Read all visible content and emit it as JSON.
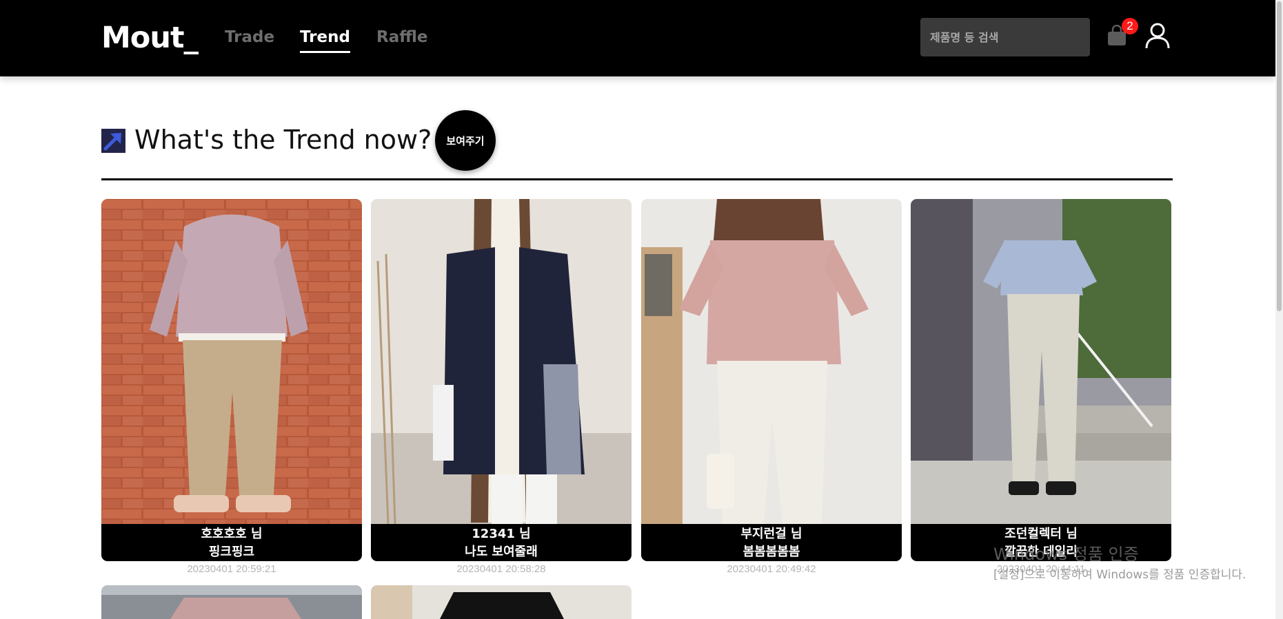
{
  "header": {
    "logo": "Mout_",
    "tabs": [
      {
        "label": "Trade",
        "active": false
      },
      {
        "label": "Trend",
        "active": true
      },
      {
        "label": "Raffle",
        "active": false
      }
    ],
    "search": {
      "placeholder": "제품명 등 검색",
      "value": ""
    },
    "cart": {
      "icon": "shopping-bag-icon",
      "badge_count": "2"
    },
    "user": {
      "icon": "user-icon"
    }
  },
  "section": {
    "title": "What's the Trend now?",
    "icon": "trend-arrow-icon",
    "show_button_label": "보여주기"
  },
  "cards": [
    {
      "author": "호호호호 님",
      "title": "핑크핑크",
      "date": "20230401 20:59:21"
    },
    {
      "author": "12341 님",
      "title": "나도 보여줄래",
      "date": "20230401 20:58:28"
    },
    {
      "author": "부지런걸 님",
      "title": "봄봄봄봄봄",
      "date": "20230401 20:49:42"
    },
    {
      "author": "조던컬렉터 님",
      "title": "깔끔한 데일리",
      "date": "20230401 20:44:11"
    }
  ],
  "watermark": {
    "title": "Windows 정품 인증",
    "subtitle": "[설정]으로 이동하여 Windows를 정품 인증합니다."
  },
  "colors": {
    "header_bg": "#000000",
    "accent_active": "#ffffff",
    "tab_inactive": "#6e6e6e",
    "badge": "#ff1a1a",
    "trend_icon_bg": "#22244a",
    "trend_icon_arrow": "#3d5bd9"
  }
}
